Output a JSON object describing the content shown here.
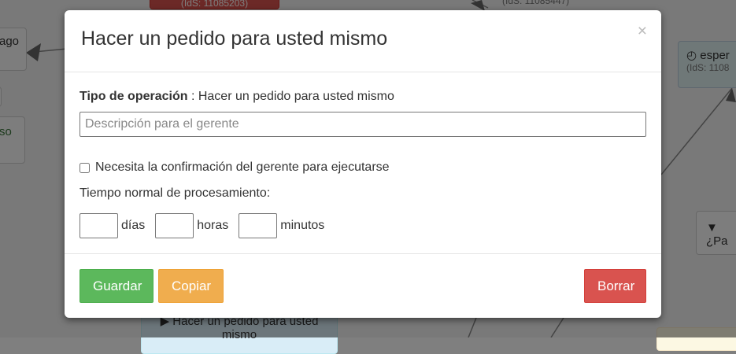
{
  "background": {
    "node_top_ids": "(IdS: 11085203)",
    "node_top_mid_ids": "(IdS: 11085447)",
    "node_left_1": "ago",
    "node_left_2": "so",
    "node_right_title": "esper",
    "node_right_ids": "(IdS: 1108",
    "node_right_filter": "¿Pa",
    "node_bottom_label": "Hacer un pedido para usted mismo"
  },
  "modal": {
    "title": "Hacer un pedido para usted mismo",
    "close_glyph": "×",
    "operation_label": "Tipo de operación",
    "operation_separator": " : ",
    "operation_value": "Hacer un pedido para usted mismo",
    "description_placeholder": "Descripción para el gerente",
    "description_value": "",
    "confirm_label": "Necesita la confirmación del gerente para ejecutarse",
    "confirm_checked": false,
    "time_label": "Tiempo normal de procesamiento:",
    "days_unit": "días",
    "hours_unit": "horas",
    "minutes_unit": "minutos",
    "days_value": "",
    "hours_value": "",
    "minutes_value": ""
  },
  "buttons": {
    "save": "Guardar",
    "copy": "Copiar",
    "delete": "Borrar"
  },
  "colors": {
    "save": "#5cb85c",
    "copy": "#f0ad4e",
    "delete": "#d9534f"
  }
}
